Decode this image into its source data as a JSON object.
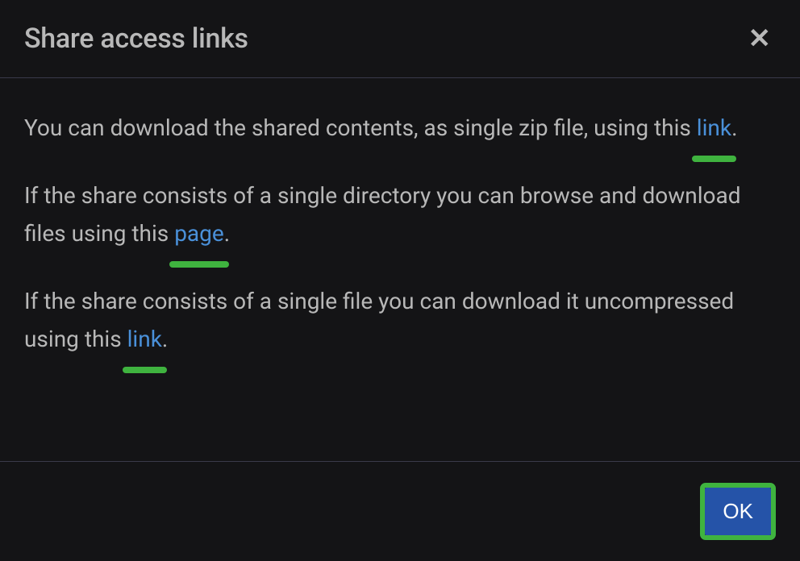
{
  "modal": {
    "title": "Share access links",
    "close_label": "✕"
  },
  "body": {
    "p1_before": "You can download the shared contents, as single zip file, using this ",
    "p1_link": "link",
    "p1_after": ".",
    "p2_before": "If the share consists of a single directory you can browse and download files using this ",
    "p2_link": "page",
    "p2_after": ".",
    "p3_before": "If the share consists of a single file you can download it uncompressed using this ",
    "p3_link": "link",
    "p3_after": "."
  },
  "footer": {
    "ok_label": "OK"
  }
}
